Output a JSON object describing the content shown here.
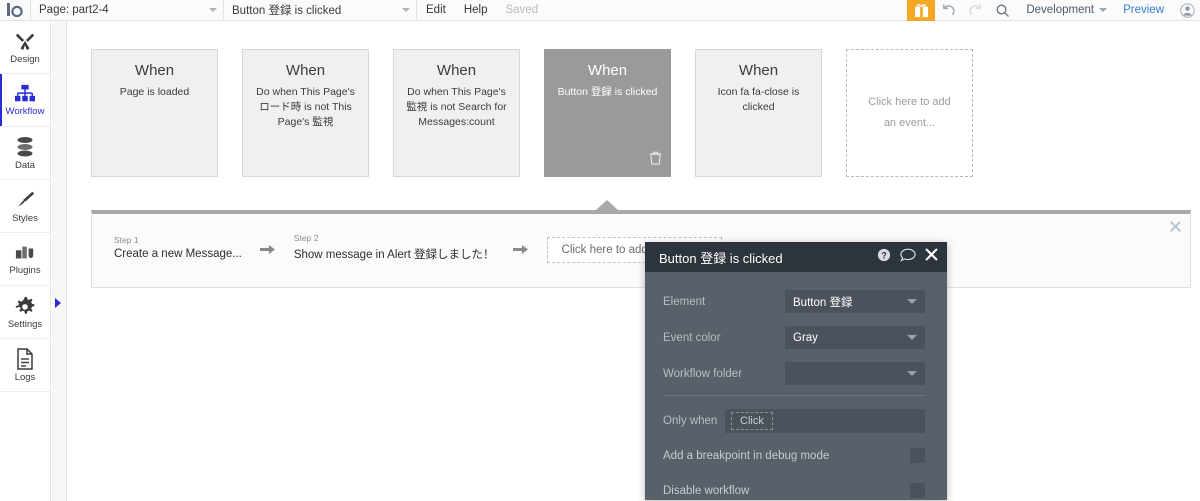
{
  "topbar": {
    "logo": "b",
    "page_selector": "Page: part2-4",
    "workflow_selector": "Button 登録 is clicked",
    "edit": "Edit",
    "help": "Help",
    "save_status": "Saved",
    "gift_icon": "gift-icon",
    "undo_icon": "undo-icon",
    "redo_icon": "redo-icon",
    "search_icon": "search-icon",
    "version": "Development",
    "preview": "Preview",
    "avatar_icon": "user-avatar-icon"
  },
  "sidebar": {
    "items": [
      {
        "label": "Design",
        "icon": "design-tools-icon",
        "active": false
      },
      {
        "label": "Workflow",
        "icon": "workflow-tree-icon",
        "active": true
      },
      {
        "label": "Data",
        "icon": "database-icon",
        "active": false
      },
      {
        "label": "Styles",
        "icon": "paintbrush-icon",
        "active": false
      },
      {
        "label": "Plugins",
        "icon": "plugins-icon",
        "active": false
      },
      {
        "label": "Settings",
        "icon": "gear-icon",
        "active": false
      },
      {
        "label": "Logs",
        "icon": "document-icon",
        "active": false
      }
    ]
  },
  "events": [
    {
      "when": "When",
      "desc": "Page is loaded",
      "selected": false,
      "placeholder": false
    },
    {
      "when": "When",
      "desc": "Do when This Page's ロード時 is not This Page's 監視",
      "selected": false,
      "placeholder": false
    },
    {
      "when": "When",
      "desc": "Do when This Page's 監視 is not Search for Messages:count",
      "selected": false,
      "placeholder": false
    },
    {
      "when": "When",
      "desc": "Button 登録 is clicked",
      "selected": true,
      "placeholder": false,
      "trash_icon": "trash-icon"
    },
    {
      "when": "When",
      "desc": "Icon fa fa-close is clicked",
      "selected": false,
      "placeholder": false
    },
    {
      "when": "",
      "desc": "Click here to add an event...",
      "selected": false,
      "placeholder": true
    }
  ],
  "steps_panel": {
    "close_icon": "close-icon",
    "steps": [
      {
        "num": "Step 1",
        "text": "Create a new Message..."
      },
      {
        "num": "Step 2",
        "text": "Show message in Alert 登録しました！"
      }
    ],
    "arrow_icon": "arrow-right-icon",
    "add_step": "Click here to add an action..."
  },
  "popup": {
    "title": "Button 登録 is clicked",
    "help_icon": "question-circle-icon",
    "comment_icon": "speech-bubble-icon",
    "close_icon": "close-icon",
    "properties": [
      {
        "label": "Element",
        "value": "Button 登録"
      },
      {
        "label": "Event color",
        "value": "Gray"
      },
      {
        "label": "Workflow folder",
        "value": ""
      }
    ],
    "only_when_label": "Only when",
    "only_when_value": "Click",
    "breakpoint_label": "Add a breakpoint in debug mode",
    "disable_label": "Disable workflow"
  },
  "colors": {
    "accent": "#2b2bd6",
    "selected_card": "#9a9a9a",
    "popup_header": "#2d343c",
    "popup_body": "#58606a",
    "gift": "#f5a623",
    "link": "#2f7fd0"
  }
}
